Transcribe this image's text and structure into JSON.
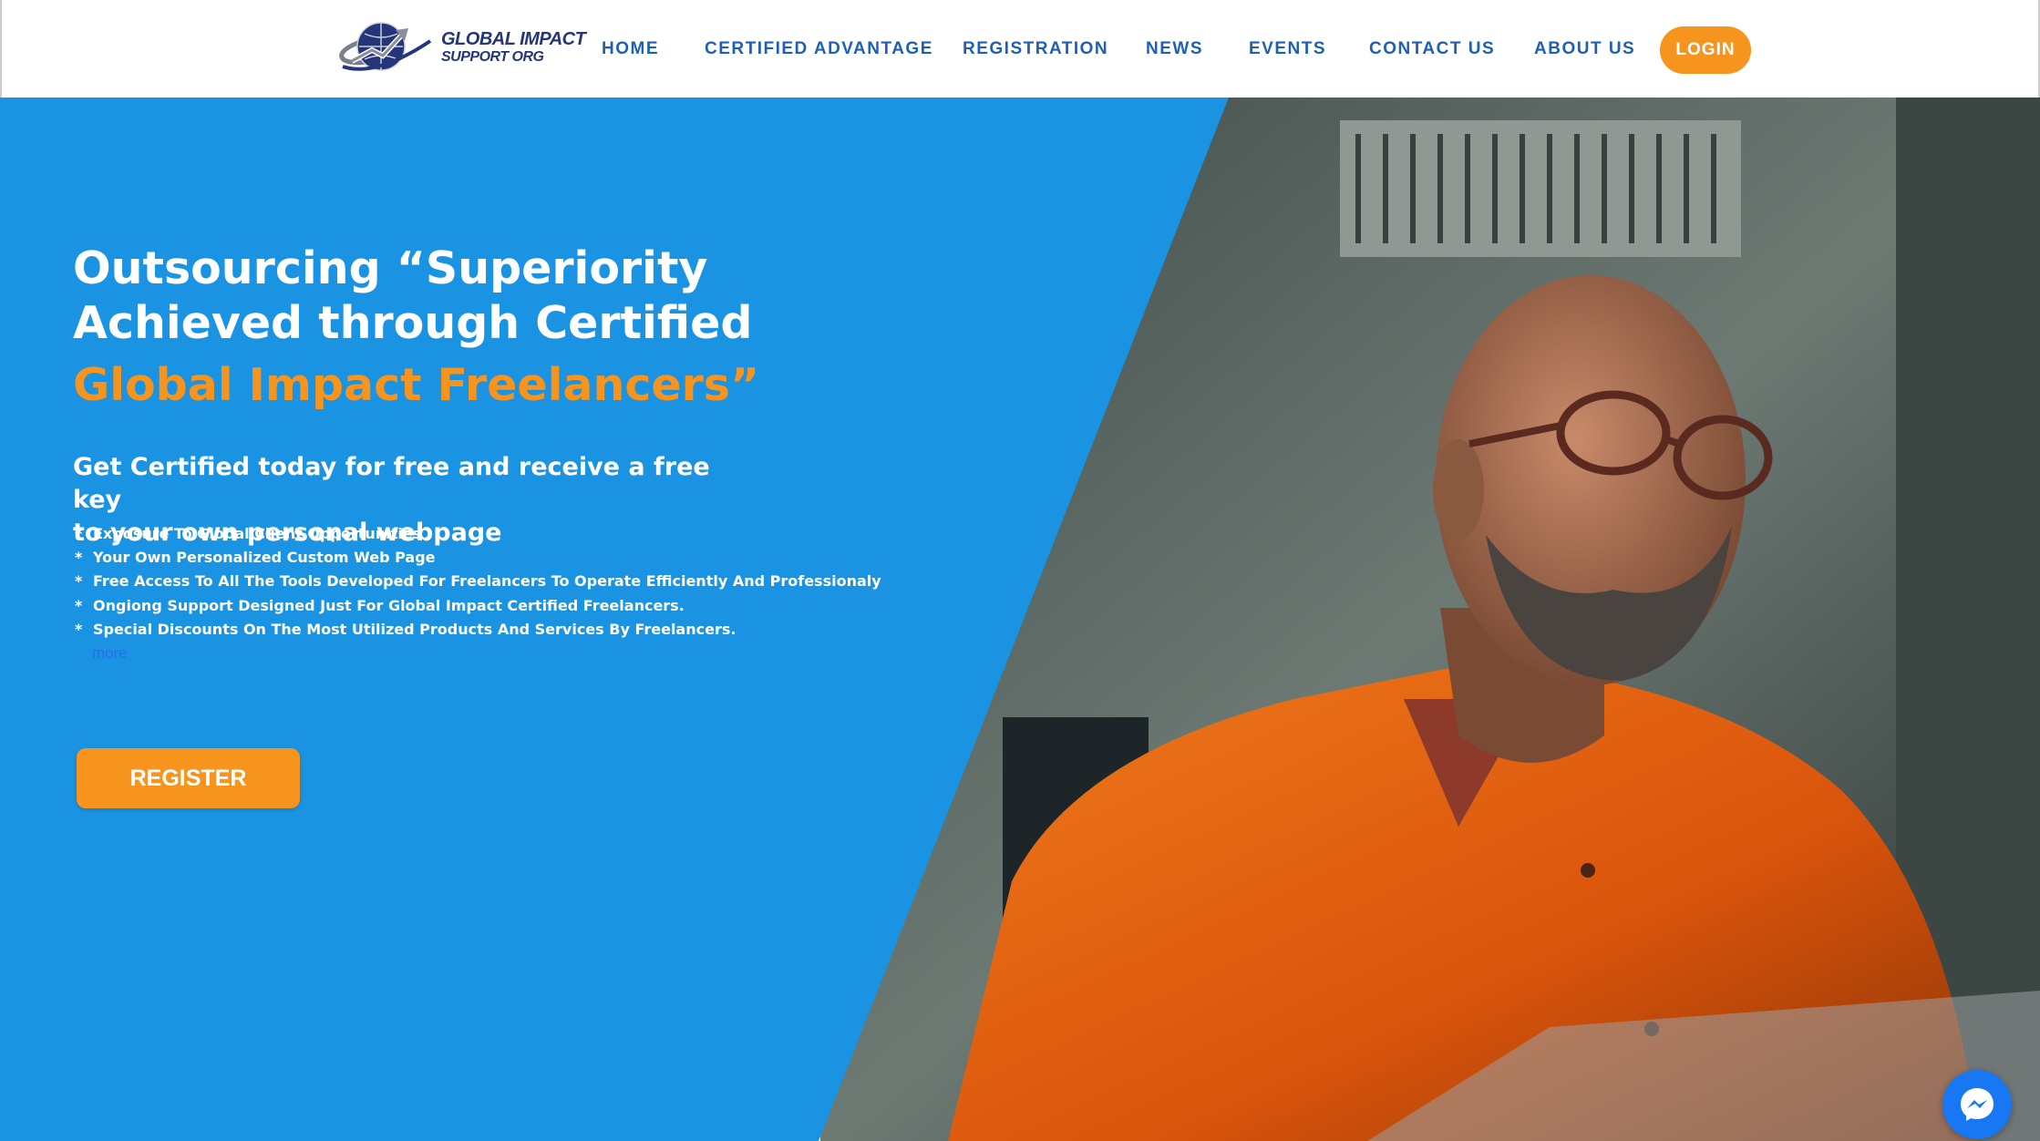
{
  "brand": {
    "name_line1": "GLOBAL IMPACT",
    "name_line2": "SUPPORT ORG"
  },
  "nav": {
    "items": [
      {
        "label": "HOME"
      },
      {
        "label": "CERTIFIED ADVANTAGE"
      },
      {
        "label": "REGISTRATION"
      },
      {
        "label": "NEWS"
      },
      {
        "label": "EVENTS"
      },
      {
        "label": "CONTACT US"
      },
      {
        "label": "ABOUT US"
      }
    ],
    "login_label": "LOGIN"
  },
  "hero": {
    "headline_line1": "Outsourcing “Superiority",
    "headline_line2": "Achieved through Certified",
    "headline_highlight": "Global Impact Freelancers”",
    "subhead_line1": "Get Certified today for free and receive a free key",
    "subhead_line2": "to your own personal webpage",
    "bullets": [
      "Exposure To Global Client Opportunities",
      "Your Own Personalized Custom Web Page",
      "Free Access To All The Tools Developed For Freelancers To Operate Efficiently And Professionaly",
      "Ongiong Support Designed Just For Global Impact Certified Freelancers.",
      "Special Discounts On The Most Utilized Products And Services By Freelancers."
    ],
    "bullet_marker": "*",
    "more_label": "more",
    "register_label": "REGISTER"
  },
  "icons": {
    "logo": "globe-logo-icon",
    "chat": "messenger-icon"
  },
  "colors": {
    "hero_blue": "#1a93e2",
    "accent_orange": "#f7941d",
    "nav_text": "#1f5fb4",
    "brand_navy": "#24357a",
    "messenger_blue": "#1877f2"
  }
}
